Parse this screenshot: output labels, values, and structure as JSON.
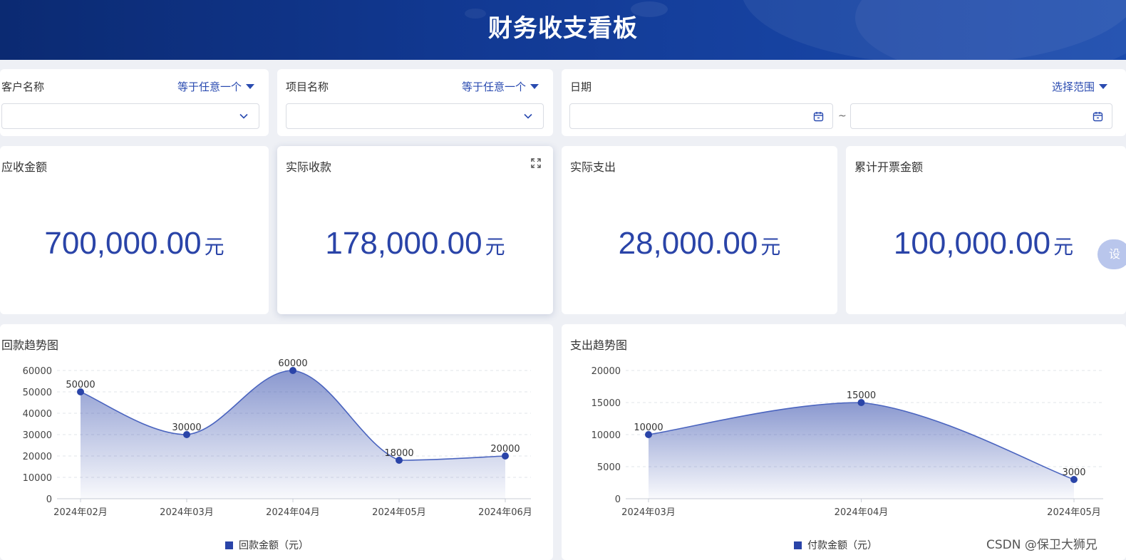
{
  "header": {
    "title": "财务收支看板"
  },
  "filters": {
    "customer": {
      "label": "客户名称",
      "operator": "等于任意一个",
      "value": ""
    },
    "project": {
      "label": "项目名称",
      "operator": "等于任意一个",
      "value": ""
    },
    "date": {
      "label": "日期",
      "operator": "选择范围",
      "start": "",
      "end": "",
      "separator": "~"
    }
  },
  "kpis": [
    {
      "label": "应收金额",
      "value": "700,000.00",
      "unit": "元"
    },
    {
      "label": "实际收款",
      "value": "178,000.00",
      "unit": "元"
    },
    {
      "label": "实际支出",
      "value": "28,000.00",
      "unit": "元"
    },
    {
      "label": "累计开票金额",
      "value": "100,000.00",
      "unit": "元"
    }
  ],
  "side_bubble": {
    "text": "设"
  },
  "watermark": "CSDN @保卫大狮兄",
  "colors": {
    "accent": "#2a44a8",
    "header_start": "#0b2a72",
    "header_end": "#1c4cae"
  },
  "chart_data": [
    {
      "type": "area",
      "title": "回款趋势图",
      "categories": [
        "2024年02月",
        "2024年03月",
        "2024年04月",
        "2024年05月",
        "2024年06月"
      ],
      "series": [
        {
          "name": "回款金额（元）",
          "values": [
            50000,
            30000,
            60000,
            18000,
            20000
          ]
        }
      ],
      "ylim": [
        0,
        60000
      ],
      "yticks": [
        0,
        10000,
        20000,
        30000,
        40000,
        50000,
        60000
      ],
      "smooth": true,
      "grid": "dashed-horizontal",
      "legend": "bottom-center"
    },
    {
      "type": "area",
      "title": "支出趋势图",
      "categories": [
        "2024年03月",
        "2024年04月",
        "2024年05月"
      ],
      "series": [
        {
          "name": "付款金额（元）",
          "values": [
            10000,
            15000,
            3000
          ]
        }
      ],
      "ylim": [
        0,
        20000
      ],
      "yticks": [
        0,
        5000,
        10000,
        15000,
        20000
      ],
      "smooth": true,
      "grid": "dashed-horizontal",
      "legend": "bottom-center"
    }
  ]
}
